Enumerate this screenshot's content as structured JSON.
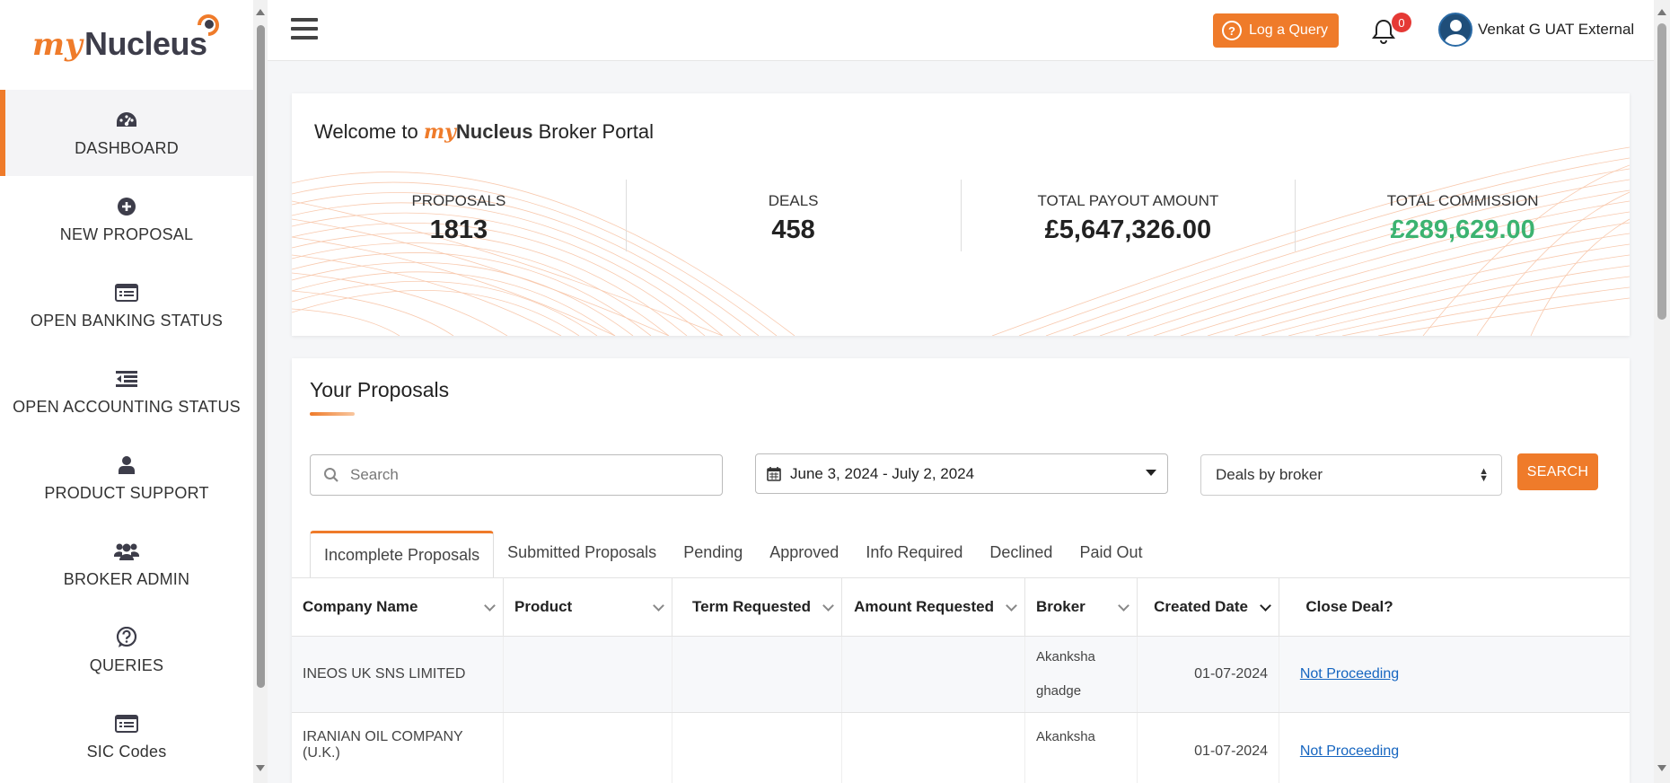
{
  "brand": {
    "logo_my": "my",
    "logo_nucleus": "Nucleus",
    "accent": "#ef7b2a",
    "green": "#3cb371"
  },
  "sidebar": {
    "items": [
      {
        "label": "DASHBOARD",
        "icon": "dashboard-gauge-icon",
        "active": true
      },
      {
        "label": "NEW PROPOSAL",
        "icon": "plus-circle-icon"
      },
      {
        "label": "OPEN BANKING STATUS",
        "icon": "list-alt-icon"
      },
      {
        "label": "OPEN ACCOUNTING STATUS",
        "icon": "indent-list-icon"
      },
      {
        "label": "PRODUCT SUPPORT",
        "icon": "user-icon"
      },
      {
        "label": "BROKER ADMIN",
        "icon": "users-icon"
      },
      {
        "label": "QUERIES",
        "icon": "question-circle-icon"
      },
      {
        "label": "SIC Codes",
        "icon": "list-alt-icon"
      }
    ]
  },
  "header": {
    "query_label": "Log a Query",
    "notifications_count": "0",
    "user_name": "Venkat G UAT External"
  },
  "welcome": {
    "prefix": "Welcome to ",
    "my": "my",
    "nucleus": "Nucleus",
    "suffix": " Broker Portal",
    "stats": [
      {
        "label": "PROPOSALS",
        "value": "1813"
      },
      {
        "label": "DEALS",
        "value": "458"
      },
      {
        "label": "TOTAL PAYOUT AMOUNT",
        "value": "£5,647,326.00"
      },
      {
        "label": "TOTAL COMMISSION",
        "value": "£289,629.00"
      }
    ]
  },
  "proposals": {
    "title": "Your Proposals",
    "search_placeholder": "Search",
    "date_range": "June 3, 2024 - July 2, 2024",
    "filter_selected": "Deals by broker",
    "search_button": "SEARCH",
    "tabs": [
      "Incomplete Proposals",
      "Submitted Proposals",
      "Pending",
      "Approved",
      "Info Required",
      "Declined",
      "Paid Out"
    ],
    "columns": [
      "Company Name",
      "Product",
      "Term Requested",
      "Amount Requested",
      "Broker",
      "Created Date",
      "Close Deal?"
    ],
    "rows": [
      {
        "company": "INEOS UK SNS LIMITED",
        "product": "",
        "term": "",
        "amount": "",
        "broker_first": "Akanksha",
        "broker_last": "ghadge",
        "created": "01-07-2024",
        "close": "Not Proceeding"
      },
      {
        "company": "IRANIAN OIL COMPANY (U.K.)",
        "product": "",
        "term": "",
        "amount": "",
        "broker_first": "Akanksha",
        "broker_last": "",
        "created": "01-07-2024",
        "close": "Not Proceeding"
      }
    ]
  }
}
